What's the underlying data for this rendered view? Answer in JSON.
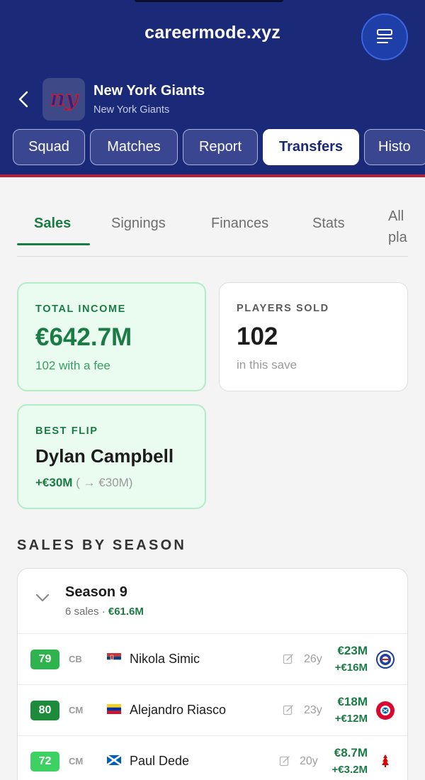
{
  "app": {
    "title": "careermode.xyz",
    "team_name": "New York Giants",
    "team_subtitle": "New York Giants",
    "colors": {
      "header": "#1a2a78",
      "accent_green": "#1b7b45",
      "header_stripe": "#b3243f"
    },
    "icons": {
      "menu": "menu-icon",
      "back": "back-chevron-icon",
      "logo": "giants-logo"
    }
  },
  "tabs": [
    {
      "label": "Squad",
      "active": false
    },
    {
      "label": "Matches",
      "active": false
    },
    {
      "label": "Report",
      "active": false
    },
    {
      "label": "Transfers",
      "active": true
    },
    {
      "label": "Histo",
      "active": false
    }
  ],
  "subtabs": [
    {
      "label": "Sales",
      "active": true
    },
    {
      "label": "Signings",
      "active": false
    },
    {
      "label": "Finances",
      "active": false
    },
    {
      "label": "Stats",
      "active": false
    },
    {
      "label": "All pla",
      "active": false
    }
  ],
  "cards": {
    "income": {
      "label": "TOTAL INCOME",
      "value": "€642.7M",
      "sub": "102 with a fee"
    },
    "sold": {
      "label": "PLAYERS SOLD",
      "value": "102",
      "sub": "in this save"
    },
    "flip": {
      "label": "BEST FLIP",
      "player": "Dylan Campbell",
      "profit": "+€30M",
      "detail": " ( → €30M)"
    }
  },
  "section_title": "SALES BY SEASON",
  "season": {
    "title": "Season 9",
    "meta_prefix": "6 sales · ",
    "meta_amount": "€61.6M",
    "rows": [
      {
        "ovr": "79",
        "ovr_color": "#2fb34f",
        "pos": "CB",
        "flag": "serbia",
        "name": "Nikola Simic",
        "age": "26y",
        "fee": "€23M",
        "profit": "+€16M",
        "club": "rangers-crest"
      },
      {
        "ovr": "80",
        "ovr_color": "#1e8a3c",
        "pos": "CM",
        "flag": "venezuela",
        "name": "Alejandro Riasco",
        "age": "23y",
        "fee": "€18M",
        "profit": "+€12M",
        "club": "bayern-crest"
      },
      {
        "ovr": "72",
        "ovr_color": "#3dd062",
        "pos": "CM",
        "flag": "scotland",
        "name": "Paul Dede",
        "age": "20y",
        "fee": "€8.7M",
        "profit": "+€3.2M",
        "club": "forest-crest"
      }
    ]
  }
}
